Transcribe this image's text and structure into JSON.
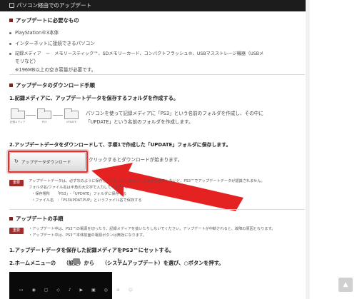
{
  "header": {
    "title": "パソコン経由でのアップデート"
  },
  "requirements": {
    "heading": "アップデートに必要なもの",
    "items": [
      "PlayStation®3本体",
      "インターネットに接続できるパソコン",
      "記録メディア　ー　メモリースティック™、SDメモリーカード、コンパクトフラッシュ®、USBマスストレージ機器（USBメ"
    ],
    "item3_cont": "モリなど）",
    "space_note": "※196MB以上の空き容量が必要です。"
  },
  "download": {
    "heading": "アップデータのダウンロード手順",
    "step1": "1.記録メディアに、アップデートデータを保存するフォルダを作成する。",
    "folders": [
      "記録メディア",
      "PS3",
      "UPDATE"
    ],
    "step1_desc_line1": "パソコンを使って記録メディアに「PS3」という名前のフォルダを作成し、その中に",
    "step1_desc_line2": "「UPDATE」という名前のフォルダを作成します。",
    "step2": "2.アップデートデータをダウンロードして、手順1で作成した「UPDATE」フォルダに保存します。",
    "button_label": "アップデータダウンロード",
    "button_desc": "クリックするとダウンロードが始まります。",
    "badge": "重要",
    "notes": [
      "アップデートデータは、必ず次のように保存してください。正しいフォルダに保存しないと、PS3™でアップデートデータが認識されません。",
      "フォルダ名/ファイル名は半角の大文字で入力してください。",
      "・保存場所　　「PS3」-「UPDATE」フォルダに保存する",
      "・ファイル名　：「PS3UPDAT.PUP」というファイル名で保存する"
    ]
  },
  "procedure": {
    "heading": "アップデートの手順",
    "badge": "重要",
    "notes": [
      "・アップデート中は、PS3™の電源を切ったり、記録メディアを抜いたりしないでください。アップデートが中断されると、故障の原因となります。",
      "・アップデート中は、PS3™本体前面の電源ボタンは無効になります。"
    ],
    "step1": "1.アップデートデータを保存した記録メディアをPS3™にセットする。",
    "step2": "2.ホームメニューの　　（設定）から　　（システムアップデート）を選び、○ボタンを押す。"
  },
  "scroll_top": "▲"
}
